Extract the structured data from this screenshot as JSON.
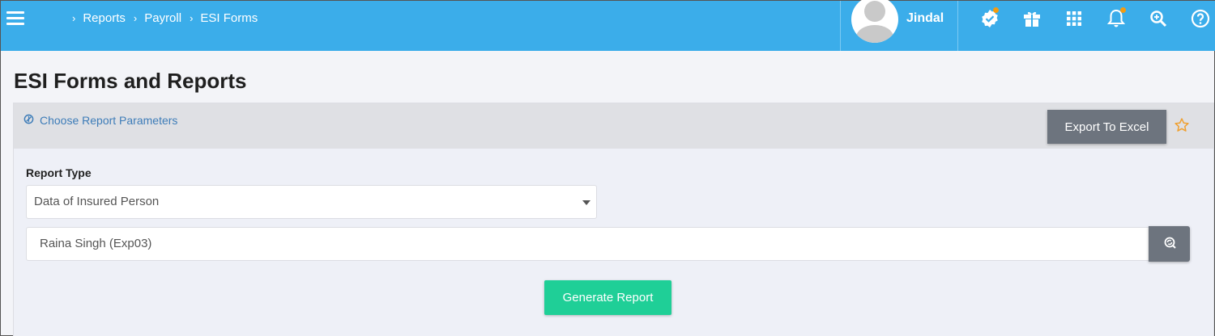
{
  "nav": {
    "menu_icon": "hamburger-icon",
    "breadcrumb": [
      "Reports",
      "Payroll",
      "ESI Forms"
    ],
    "separator": "›"
  },
  "user": {
    "name": "Jindal"
  },
  "toolbar_icons": [
    "verified-badge-icon",
    "gift-icon",
    "apps-grid-icon",
    "bell-icon",
    "search-zoom-icon",
    "help-icon"
  ],
  "page": {
    "title": "ESI Forms and Reports"
  },
  "panel": {
    "parameters_label": "Choose Report Parameters",
    "export_label": "Export To Excel",
    "report_type_label": "Report Type",
    "report_type_value": "Data of Insured Person",
    "employee_value": "Raina Singh (Exp03)",
    "generate_label": "Generate Report"
  },
  "colors": {
    "header": "#3badea",
    "export_button": "#6d747e",
    "generate_button": "#1fcf97",
    "star": "#f0a030",
    "notification_dot": "#f39c12"
  }
}
